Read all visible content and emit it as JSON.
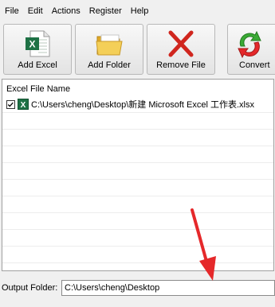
{
  "menu": {
    "items": [
      "File",
      "Edit",
      "Actions",
      "Register",
      "Help"
    ]
  },
  "toolbar": {
    "add_excel_label": "Add Excel",
    "add_folder_label": "Add Folder",
    "remove_file_label": "Remove File",
    "convert_label": "Convert"
  },
  "file_list": {
    "header": "Excel File Name",
    "files": [
      {
        "name": "C:\\Users\\cheng\\Desktop\\新建 Microsoft Excel 工作表.xlsx",
        "checked": true
      }
    ]
  },
  "output": {
    "label": "Output Folder:",
    "value": "C:\\Users\\cheng\\Desktop"
  },
  "colors": {
    "excel_green": "#1e7145",
    "remove_red": "#d0261e",
    "folder_yellow": "#f2c744",
    "annotation_arrow": "#e5282a"
  },
  "icons": {
    "add_excel": "excel-file-icon",
    "add_folder": "folder-icon",
    "remove_file": "red-x-icon",
    "convert": "convert-arrows-icon"
  }
}
